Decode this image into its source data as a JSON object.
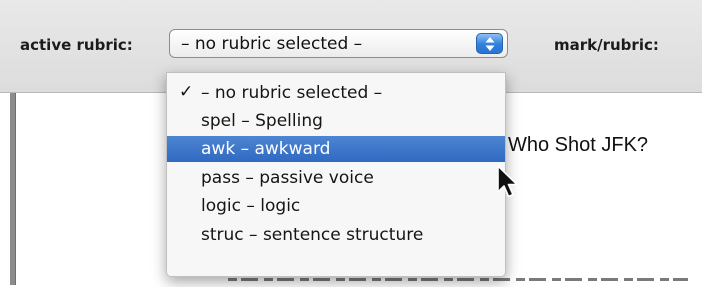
{
  "toolbar": {
    "active_rubric_label": "active rubric:",
    "mark_rubric_label": "mark/rubric:"
  },
  "rubric_select": {
    "value": "– no rubric selected –",
    "icon": "updown-arrows-icon"
  },
  "rubric_menu": {
    "items": [
      {
        "label": "– no rubric selected –",
        "checked": true,
        "highlighted": false
      },
      {
        "label": "spel – Spelling",
        "checked": false,
        "highlighted": false
      },
      {
        "label": "awk – awkward",
        "checked": false,
        "highlighted": true
      },
      {
        "label": "pass – passive voice",
        "checked": false,
        "highlighted": false
      },
      {
        "label": "logic – logic",
        "checked": false,
        "highlighted": false
      },
      {
        "label": "struc – sentence structure",
        "checked": false,
        "highlighted": false
      }
    ],
    "check_mark": "✓"
  },
  "document": {
    "heading_visible": "Who Shot JFK?"
  },
  "colors": {
    "highlight": "#3a74c8",
    "toolbar_bg": "#e2e2e2",
    "arrow_button": "#2f7fdc"
  },
  "cursor": {
    "icon": "arrow-pointer-icon"
  }
}
